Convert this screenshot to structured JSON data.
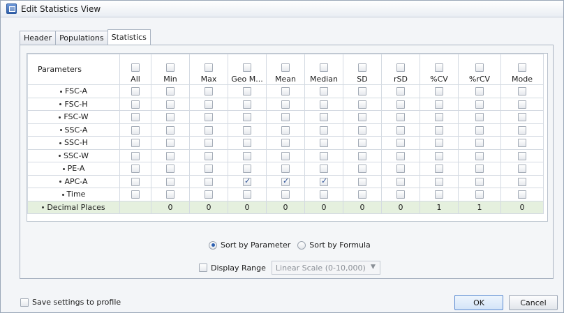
{
  "window": {
    "title": "Edit Statistics View"
  },
  "tabs": [
    {
      "label": "Header",
      "active": false
    },
    {
      "label": "Populations",
      "active": false
    },
    {
      "label": "Statistics",
      "active": true
    }
  ],
  "grid": {
    "param_header": "Parameters",
    "columns": [
      "All",
      "Min",
      "Max",
      "Geo M...",
      "Mean",
      "Median",
      "SD",
      "rSD",
      "%CV",
      "%rCV",
      "Mode"
    ],
    "rows": [
      {
        "name": "FSC-A",
        "checked": []
      },
      {
        "name": "FSC-H",
        "checked": []
      },
      {
        "name": "FSC-W",
        "checked": []
      },
      {
        "name": "SSC-A",
        "checked": []
      },
      {
        "name": "SSC-H",
        "checked": []
      },
      {
        "name": "SSC-W",
        "checked": []
      },
      {
        "name": "PE-A",
        "checked": []
      },
      {
        "name": "APC-A",
        "checked": [
          3,
          4,
          5
        ]
      },
      {
        "name": "Time",
        "checked": []
      }
    ],
    "decimal_row": {
      "label": "Decimal Places",
      "values": [
        "",
        "0",
        "0",
        "0",
        "0",
        "0",
        "0",
        "0",
        "1",
        "1",
        "0"
      ]
    }
  },
  "sort": {
    "by_parameter_label": "Sort by Parameter",
    "by_formula_label": "Sort by Formula",
    "selected": "parameter"
  },
  "display_range": {
    "label": "Display Range",
    "checked": false,
    "select_value": "Linear Scale (0-10,000)"
  },
  "footer": {
    "save_label": "Save settings to profile",
    "ok_label": "OK",
    "cancel_label": "Cancel"
  },
  "colors": {
    "decimal_row_bg": "#e5f0de",
    "accent": "#2b5fb0"
  }
}
